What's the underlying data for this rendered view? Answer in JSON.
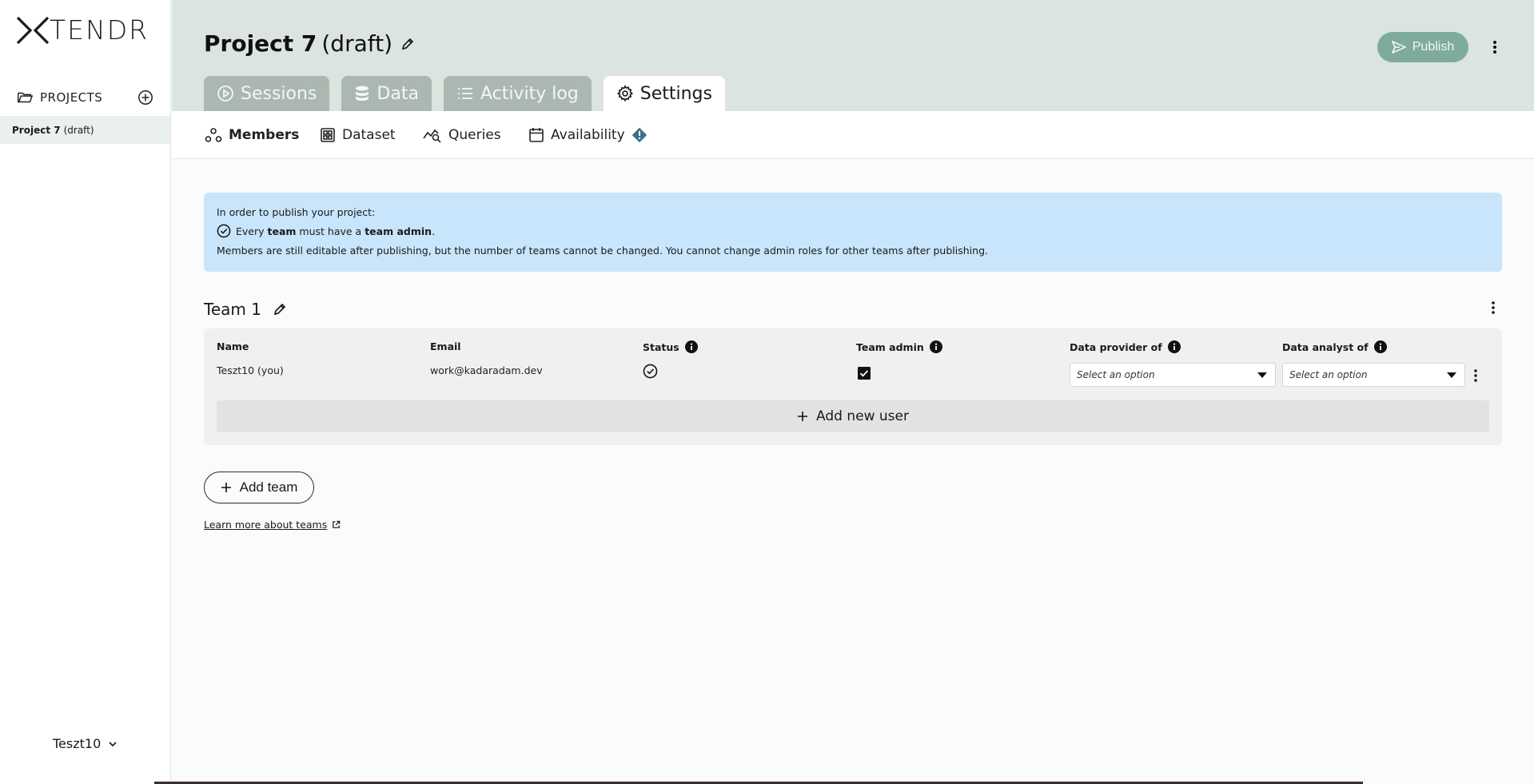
{
  "brand": {
    "logo_text": "TENDR"
  },
  "sidebar": {
    "projects_label": "PROJECTS",
    "projects": [
      {
        "name": "Project 7",
        "status": "(draft)"
      }
    ],
    "user": "Teszt10"
  },
  "header": {
    "title": "Project 7",
    "subtitle": "(draft)",
    "publish_label": "Publish"
  },
  "tabs": [
    {
      "label": "Sessions",
      "icon": "play-circle-icon"
    },
    {
      "label": "Data",
      "icon": "database-icon"
    },
    {
      "label": "Activity log",
      "icon": "list-icon"
    },
    {
      "label": "Settings",
      "icon": "gear-icon",
      "active": true
    }
  ],
  "subtabs": [
    {
      "label": "Members",
      "icon": "members-icon",
      "active": true
    },
    {
      "label": "Dataset",
      "icon": "dataset-icon"
    },
    {
      "label": "Queries",
      "icon": "queries-icon"
    },
    {
      "label": "Availability",
      "icon": "calendar-icon",
      "warning": true
    }
  ],
  "info": {
    "line1": "In order to publish your project:",
    "line2_a": "Every",
    "line2_b": "team",
    "line2_c": "must have a",
    "line2_d": "team admin",
    "line2_e": ".",
    "line3": "Members are still editable after publishing, but the number of teams cannot be changed. You cannot change admin roles for other teams after publishing."
  },
  "team": {
    "name": "Team 1",
    "columns": {
      "name": "Name",
      "email": "Email",
      "status": "Status",
      "team_admin": "Team admin",
      "data_provider": "Data provider of",
      "data_analyst": "Data analyst of"
    },
    "members": [
      {
        "name": "Teszt10 (you)",
        "email": "work@kadaradam.dev",
        "status": "check-circle-icon",
        "team_admin": true,
        "data_provider_placeholder": "Select an option",
        "data_analyst_placeholder": "Select an option"
      }
    ],
    "add_user_label": "Add new user"
  },
  "add_team_label": "Add team",
  "learn_more_label": "Learn more about teams",
  "colors": {
    "header_bg": "#dbe4df",
    "tab_inactive": "#abb8b1",
    "publish": "#7fab9a",
    "info_bg": "#c8e5fb",
    "warning": "#3d6f8c"
  }
}
